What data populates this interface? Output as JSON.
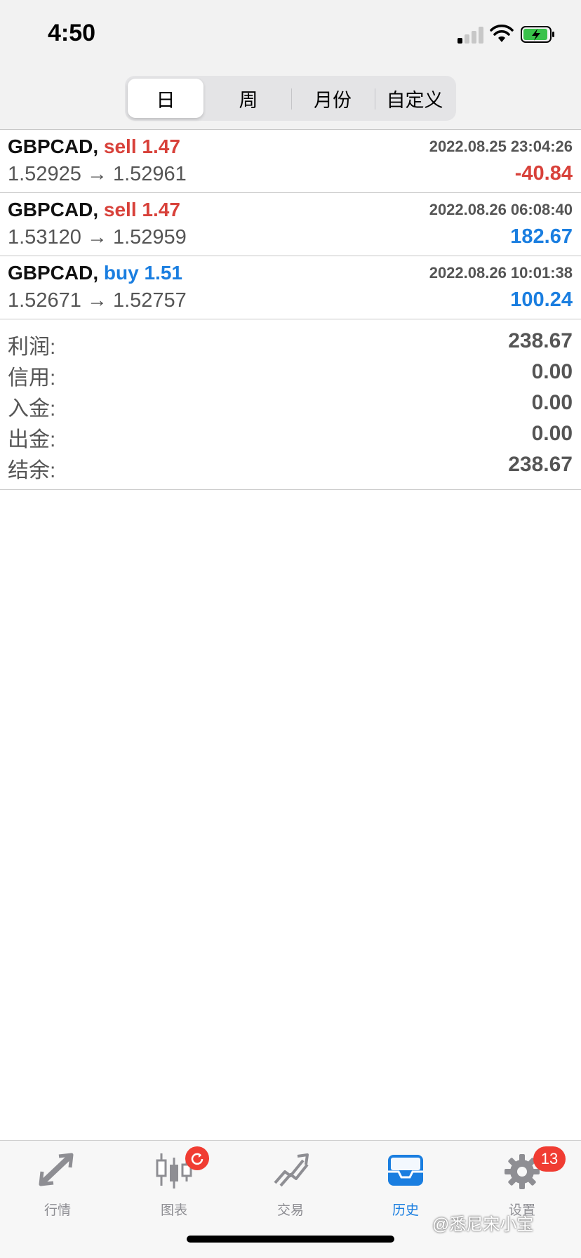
{
  "status": {
    "time": "4:50"
  },
  "segments": [
    {
      "label": "日",
      "active": true
    },
    {
      "label": "周"
    },
    {
      "label": "月份"
    },
    {
      "label": "自定义"
    }
  ],
  "trades": [
    {
      "symbol": "GBPCAD,",
      "side": "sell 1.47",
      "side_color": "#d8413a",
      "date": "2022.08.25 23:04:26",
      "prices": "1.52925 → 1.52961",
      "pl": "-40.84",
      "pl_color": "#d8413a"
    },
    {
      "symbol": "GBPCAD,",
      "side": "sell 1.47",
      "side_color": "#d8413a",
      "date": "2022.08.26 06:08:40",
      "prices": "1.53120 → 1.52959",
      "pl": "182.67",
      "pl_color": "#1a7ee0"
    },
    {
      "symbol": "GBPCAD,",
      "side": "buy 1.51",
      "side_color": "#1a7ee0",
      "date": "2022.08.26 10:01:38",
      "prices": "1.52671 → 1.52757",
      "pl": "100.24",
      "pl_color": "#1a7ee0"
    }
  ],
  "summary": [
    {
      "label": "利润:",
      "value": "238.67"
    },
    {
      "label": "信用:",
      "value": "0.00"
    },
    {
      "label": "入金:",
      "value": "0.00"
    },
    {
      "label": "出金:",
      "value": "0.00"
    },
    {
      "label": "结余:",
      "value": "238.67"
    }
  ],
  "tabs": [
    {
      "label": "行情",
      "icon": "quotes-arrows-icon"
    },
    {
      "label": "图表",
      "icon": "candlestick-chart-icon",
      "badge": "refresh"
    },
    {
      "label": "交易",
      "icon": "trade-chart-icon"
    },
    {
      "label": "历史",
      "icon": "history-inbox-icon",
      "active": true
    },
    {
      "label": "设置",
      "icon": "gear-icon",
      "badge": "13"
    }
  ],
  "watermark": "@悉尼宋小宝",
  "colors": {
    "sell": "#d8413a",
    "buy": "#1a7ee0",
    "accent": "#1a7ee0",
    "badge": "#f03c32"
  }
}
